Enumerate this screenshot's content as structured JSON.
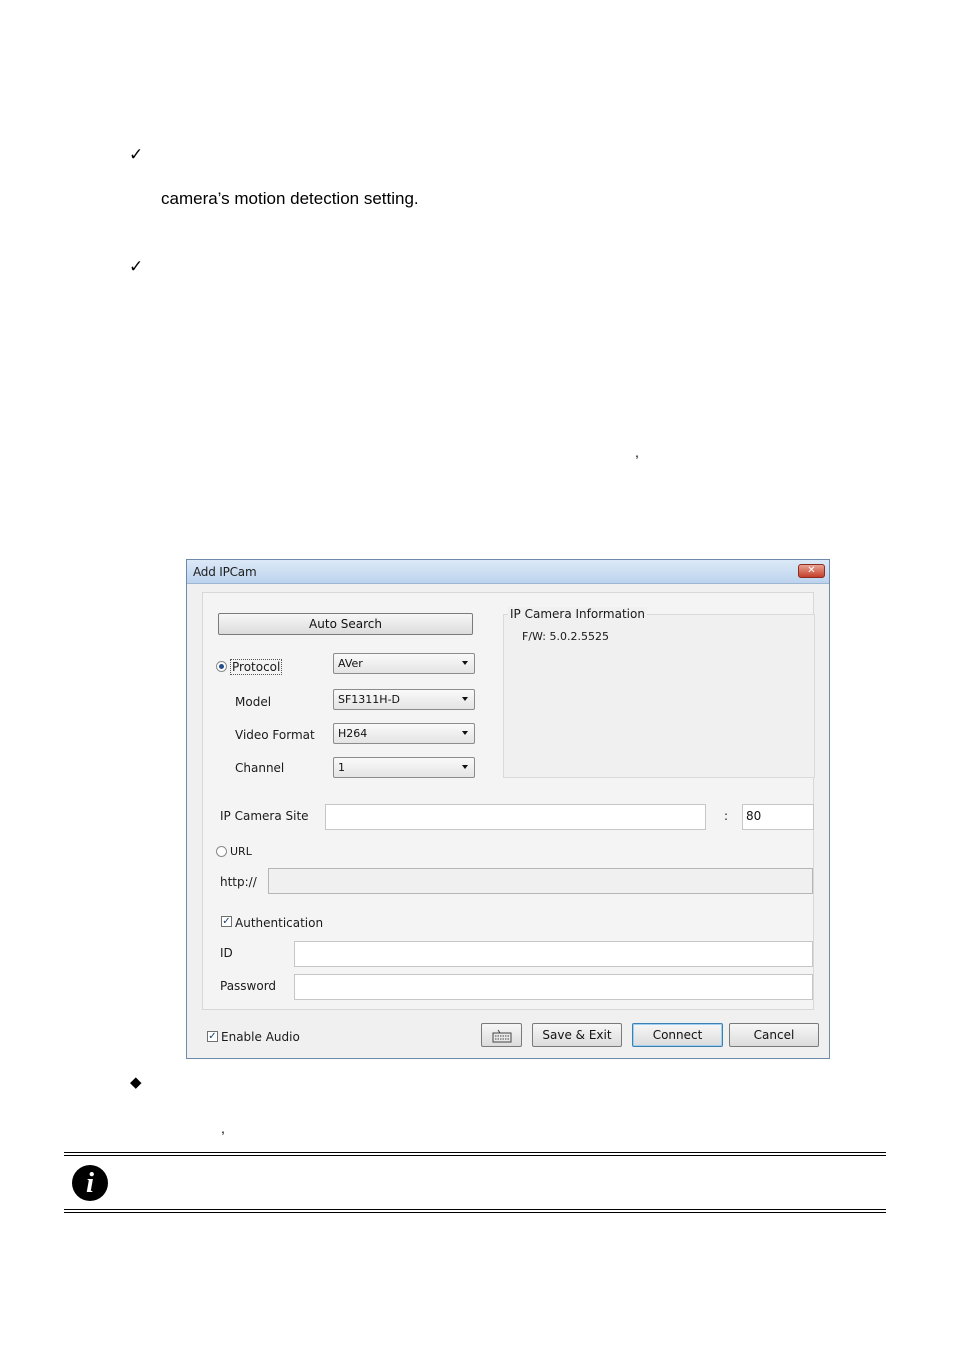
{
  "document": {
    "check_1": "✓",
    "line_motion": "camera’s motion detection setting.",
    "check_2": "✓",
    "comma_1": ",",
    "bullet": "◆",
    "comma_2": ","
  },
  "dialog": {
    "title": "Add IPCam",
    "close_symbol": "✕",
    "auto_search_label": "Auto Search",
    "protocol_label": "Protocol",
    "protocol_value": "AVer",
    "model_label": "Model",
    "model_value": "SF1311H-D",
    "video_format_label": "Video Format",
    "video_format_value": "H264",
    "channel_label": "Channel",
    "channel_value": "1",
    "info_group_title": "IP Camera Information",
    "firmware": "F/W: 5.0.2.5525",
    "ip_site_label": "IP Camera Site",
    "ip_site_value": "",
    "port_sep": ":",
    "port_value": "80",
    "url_label": "URL",
    "http_label": "http://",
    "url_value": "",
    "authentication_label": "Authentication",
    "authentication_checked": true,
    "id_label": "ID",
    "id_value": "",
    "password_label": "Password",
    "password_value": "",
    "enable_audio_label": "Enable Audio",
    "enable_audio_checked": true,
    "save_exit_label": "Save & Exit",
    "connect_label": "Connect",
    "cancel_label": "Cancel",
    "checkbox_symbol": "✓"
  },
  "note": {
    "info_symbol": "i"
  }
}
